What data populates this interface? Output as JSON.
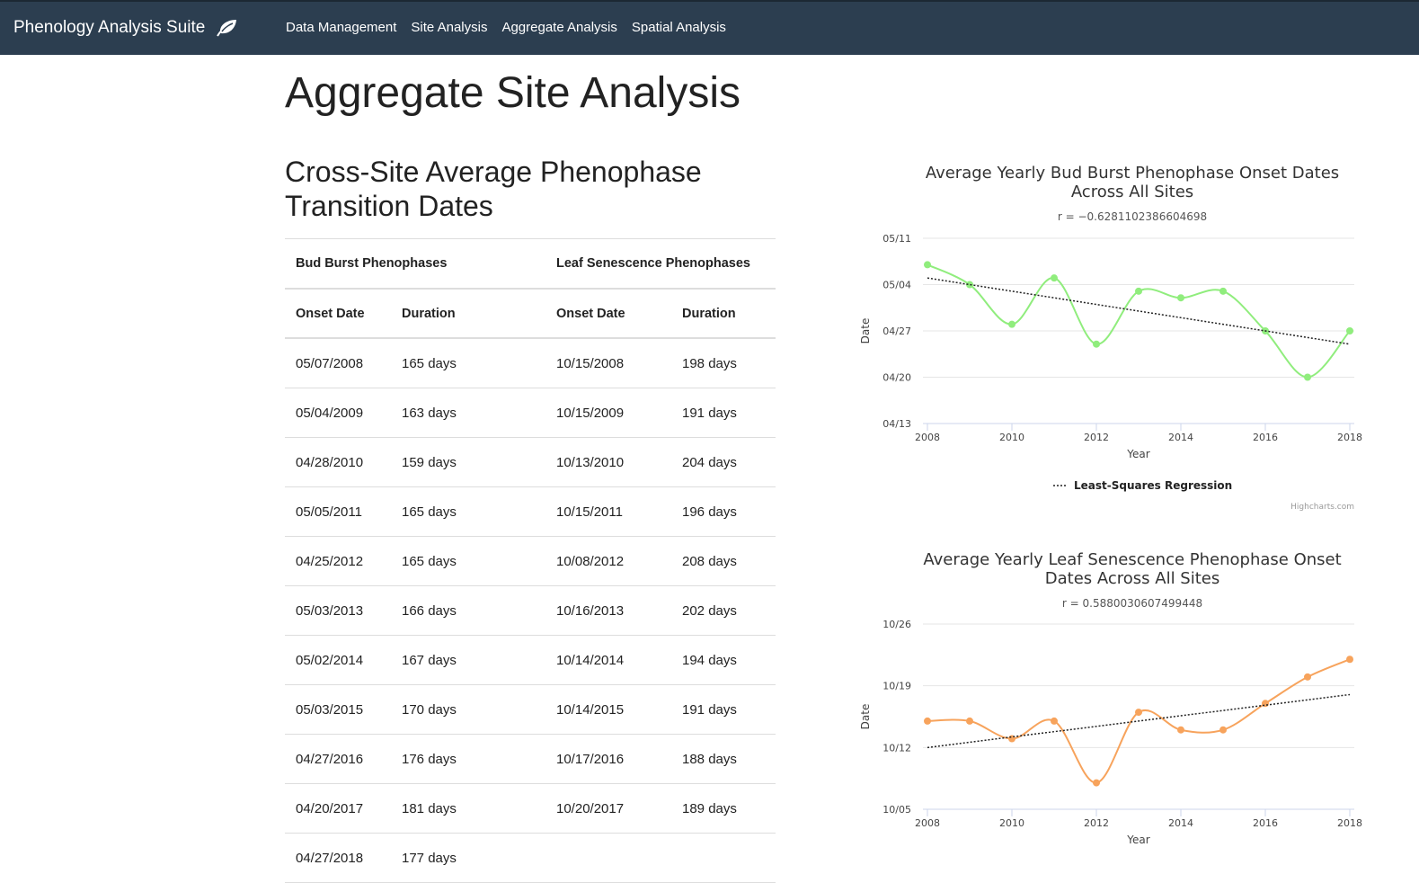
{
  "navbar": {
    "brand": "Phenology Analysis Suite",
    "brand_icon": "leaf-icon",
    "links": [
      "Data Management",
      "Site Analysis",
      "Aggregate Analysis",
      "Spatial Analysis"
    ]
  },
  "page": {
    "title": "Aggregate Site Analysis",
    "table_heading": "Cross-Site Average Phenophase Transition Dates"
  },
  "table": {
    "group_headers": [
      "Bud Burst Phenophases",
      "Leaf Senescence Phenophases"
    ],
    "column_headers": [
      "Onset Date",
      "Duration",
      "Onset Date",
      "Duration"
    ],
    "rows": [
      [
        "05/07/2008",
        "165 days",
        "10/15/2008",
        "198 days"
      ],
      [
        "05/04/2009",
        "163 days",
        "10/15/2009",
        "191 days"
      ],
      [
        "04/28/2010",
        "159 days",
        "10/13/2010",
        "204 days"
      ],
      [
        "05/05/2011",
        "165 days",
        "10/15/2011",
        "196 days"
      ],
      [
        "04/25/2012",
        "165 days",
        "10/08/2012",
        "208 days"
      ],
      [
        "05/03/2013",
        "166 days",
        "10/16/2013",
        "202 days"
      ],
      [
        "05/02/2014",
        "167 days",
        "10/14/2014",
        "194 days"
      ],
      [
        "05/03/2015",
        "170 days",
        "10/14/2015",
        "191 days"
      ],
      [
        "04/27/2016",
        "176 days",
        "10/17/2016",
        "188 days"
      ],
      [
        "04/20/2017",
        "181 days",
        "10/20/2017",
        "189 days"
      ],
      [
        "04/27/2018",
        "177 days",
        "",
        ""
      ]
    ]
  },
  "chart_data": [
    {
      "type": "line",
      "title": "Average Yearly Bud Burst Phenophase Onset Dates Across All Sites",
      "subtitle": "r = −0.6281102386604698",
      "xlabel": "Year",
      "ylabel": "Date",
      "x_ticks": [
        "2008",
        "2010",
        "2012",
        "2014",
        "2016",
        "2018"
      ],
      "y_ticks": [
        "05/11",
        "05/04",
        "04/27",
        "04/20",
        "04/13"
      ],
      "x": [
        2008,
        2009,
        2010,
        2011,
        2012,
        2013,
        2014,
        2015,
        2016,
        2017,
        2018
      ],
      "series": [
        {
          "values": [
            "05/07",
            "05/04",
            "04/28",
            "05/05",
            "04/25",
            "05/03",
            "05/02",
            "05/03",
            "04/27",
            "04/20",
            "04/27"
          ],
          "color": "#90ed7d"
        }
      ],
      "regression": {
        "name": "Least-Squares Regression",
        "start": "05/05",
        "end": "04/25"
      },
      "ylim": [
        "04/13",
        "05/11"
      ],
      "grid": true,
      "legend": "bottom-center",
      "credits": "Highcharts.com"
    },
    {
      "type": "line",
      "title": "Average Yearly Leaf Senescence Phenophase Onset Dates Across All Sites",
      "subtitle": "r = 0.5880030607499448",
      "xlabel": "Year",
      "ylabel": "Date",
      "x_ticks": [
        "2008",
        "2010",
        "2012",
        "2014",
        "2016",
        "2018"
      ],
      "y_ticks": [
        "10/26",
        "10/19",
        "10/12",
        "10/05"
      ],
      "x": [
        2008,
        2009,
        2010,
        2011,
        2012,
        2013,
        2014,
        2015,
        2016,
        2017,
        2018
      ],
      "series": [
        {
          "values": [
            "10/15",
            "10/15",
            "10/13",
            "10/15",
            "10/08",
            "10/16",
            "10/14",
            "10/14",
            "10/17",
            "10/20",
            "10/22"
          ],
          "color": "#f7a35c"
        }
      ],
      "regression": {
        "start": "10/12",
        "end": "10/18"
      },
      "ylim": [
        "10/05",
        "10/26"
      ],
      "grid": true
    }
  ]
}
